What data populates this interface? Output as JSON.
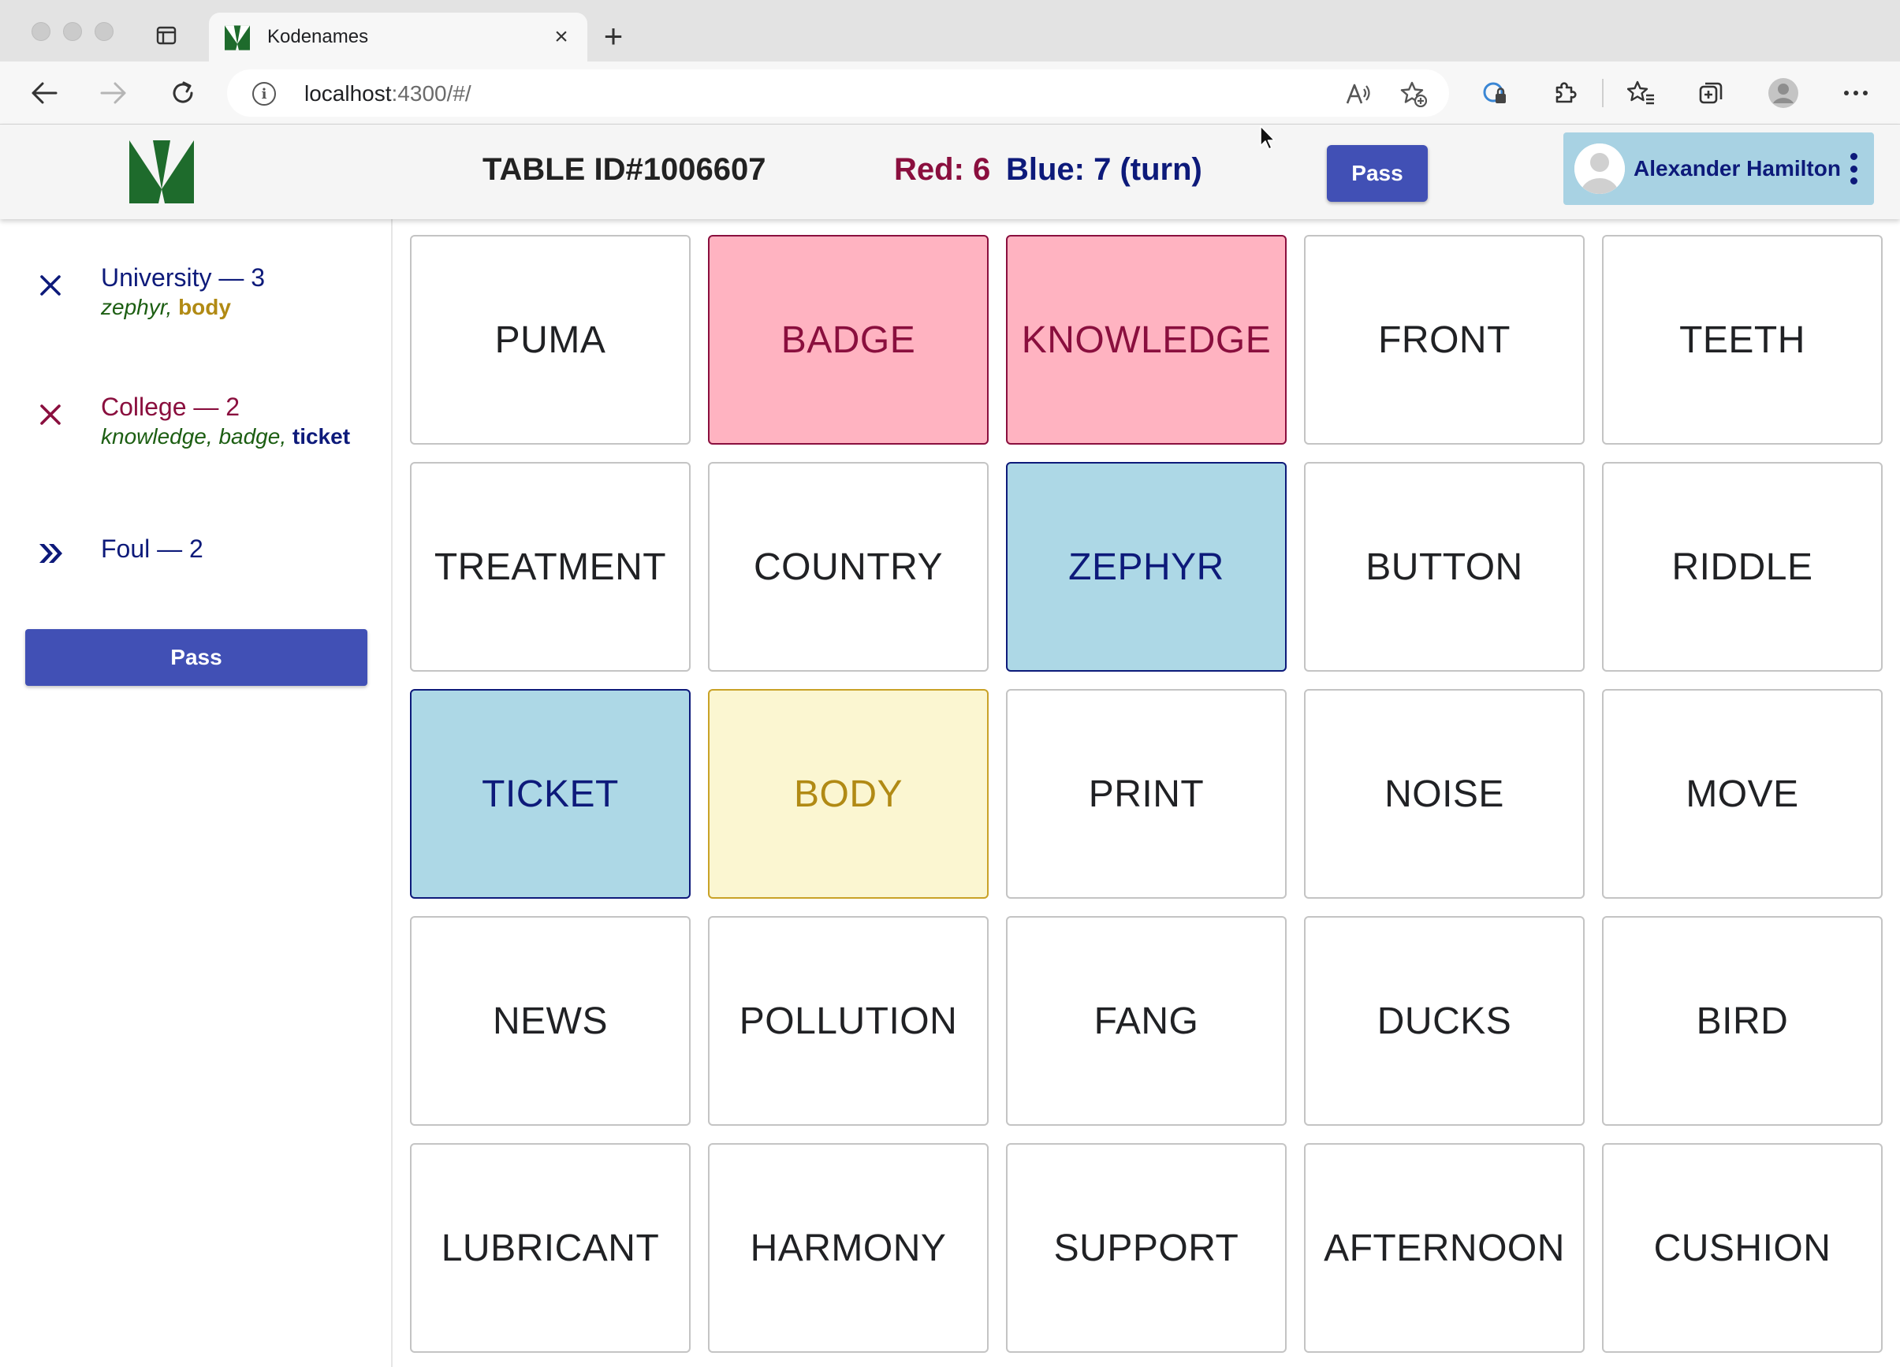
{
  "browser": {
    "tab_title": "Kodenames",
    "url_host": "localhost",
    "url_path": ":4300/#/"
  },
  "header": {
    "table_id": "TABLE ID#1006607",
    "red_score": "Red: 6",
    "blue_score": "Blue: 7 (turn)",
    "pass_label": "Pass",
    "user_name": "Alexander Hamilton"
  },
  "sidebar": {
    "clues": [
      {
        "word": "University — 3",
        "word_color": "#0d1a7a",
        "icon": "close-icon",
        "icon_color": "#0d1a7a",
        "guesses": [
          {
            "text": "zephyr",
            "type": "green"
          },
          {
            "text": ", ",
            "type": "sep"
          },
          {
            "text": "body",
            "type": "gold"
          }
        ]
      },
      {
        "word": "College — 2",
        "word_color": "#8a0f3e",
        "icon": "close-icon",
        "icon_color": "#8a0f3e",
        "guesses": [
          {
            "text": "knowledge",
            "type": "green"
          },
          {
            "text": ", ",
            "type": "sep"
          },
          {
            "text": "badge",
            "type": "green"
          },
          {
            "text": ", ",
            "type": "sep"
          },
          {
            "text": "ticket",
            "type": "blue"
          }
        ]
      },
      {
        "word": "Foul — 2",
        "word_color": "#0d1a7a",
        "icon": "double-chevron-right-icon",
        "icon_color": "#0d1a7a",
        "guesses": []
      }
    ],
    "pass_label": "Pass"
  },
  "board": {
    "cards": [
      {
        "word": "PUMA",
        "state": "unrevealed"
      },
      {
        "word": "BADGE",
        "state": "red"
      },
      {
        "word": "KNOWLEDGE",
        "state": "red"
      },
      {
        "word": "FRONT",
        "state": "unrevealed"
      },
      {
        "word": "TEETH",
        "state": "unrevealed"
      },
      {
        "word": "TREATMENT",
        "state": "unrevealed"
      },
      {
        "word": "COUNTRY",
        "state": "unrevealed"
      },
      {
        "word": "ZEPHYR",
        "state": "blue"
      },
      {
        "word": "BUTTON",
        "state": "unrevealed"
      },
      {
        "word": "RIDDLE",
        "state": "unrevealed"
      },
      {
        "word": "TICKET",
        "state": "blue"
      },
      {
        "word": "BODY",
        "state": "neutral"
      },
      {
        "word": "PRINT",
        "state": "unrevealed"
      },
      {
        "word": "NOISE",
        "state": "unrevealed"
      },
      {
        "word": "MOVE",
        "state": "unrevealed"
      },
      {
        "word": "NEWS",
        "state": "unrevealed"
      },
      {
        "word": "POLLUTION",
        "state": "unrevealed"
      },
      {
        "word": "FANG",
        "state": "unrevealed"
      },
      {
        "word": "DUCKS",
        "state": "unrevealed"
      },
      {
        "word": "BIRD",
        "state": "unrevealed"
      },
      {
        "word": "LUBRICANT",
        "state": "unrevealed"
      },
      {
        "word": "HARMONY",
        "state": "unrevealed"
      },
      {
        "word": "SUPPORT",
        "state": "unrevealed"
      },
      {
        "word": "AFTERNOON",
        "state": "unrevealed"
      },
      {
        "word": "CUSHION",
        "state": "unrevealed"
      }
    ]
  },
  "colors": {
    "red_team": "#8a0f3e",
    "blue_team": "#0d1a7a",
    "button": "#4150b5",
    "red_card_bg": "#ffb3c1",
    "blue_card_bg": "#add8e6",
    "neutral_card_bg": "#fbf6d1"
  }
}
